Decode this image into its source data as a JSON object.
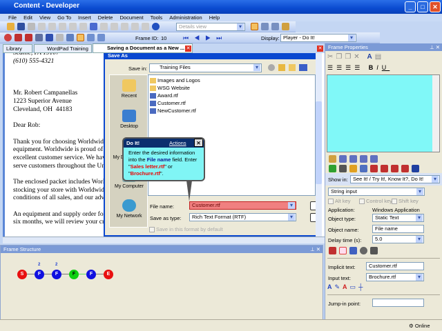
{
  "window": {
    "title": "Content - Developer"
  },
  "menu": [
    "File",
    "Edit",
    "View",
    "Go To",
    "Insert",
    "Delete",
    "Document",
    "Tools",
    "Administration",
    "Help"
  ],
  "toolbar": {
    "view_select": "Details view",
    "frame_id_label": "Frame ID:",
    "frame_id": "10",
    "display_label": "Display:",
    "display_value": "Player - Do It!"
  },
  "tabs": [
    {
      "label": "Library"
    },
    {
      "label": "WordPad Training"
    },
    {
      "label": "Saving a Document as a New ..."
    }
  ],
  "document": {
    "lines": [
      "Seattle, PA 19107",
      "(610) 555-4321",
      "",
      "",
      "",
      "Mr. Robert Campanellas",
      "1223 Superior Avenue",
      "Cleveland, OH  44183",
      "",
      "Dear Rob:",
      "",
      "Thank you for choosing Worldwide",
      "equipment. Worldwide is proud of",
      "excellent customer service. We hav",
      "serve customers throughout the Uni",
      "",
      "The enclosed packet includes Worl",
      "stocking your store with Worldwide",
      "conditions of all sales, and our adve",
      "",
      "An equipment and supply order for",
      "six months, we will review your credit"
    ]
  },
  "dialog": {
    "title": "Save As",
    "save_in_label": "Save in:",
    "save_in": "Training Files",
    "places": [
      "Recent",
      "Desktop",
      "My Documents",
      "My Computer",
      "My Network"
    ],
    "files": [
      "Images and Logos",
      "WSG Website",
      "Award.rtf",
      "Customer.rtf",
      "NewCustomer.rtf"
    ],
    "file_name_label": "File name:",
    "file_name": "Customer.rtf",
    "save_type_label": "Save as type:",
    "save_type": "Rich Text Format (RTF)",
    "default_checkbox": "Save in this format by default"
  },
  "callout": {
    "title": "Do It!",
    "actions": "Actions",
    "t1": "Enter the desired information into the ",
    "t2": "File name",
    "t3": " field. Enter \"",
    "t4": "Sales letter.rtf",
    "t5": "\" or \"",
    "t6": "Brochure.rtf",
    "t7": "\"."
  },
  "frame_structure": {
    "title": "Frame Structure",
    "nodes": [
      {
        "label": "S",
        "color": "#e81010"
      },
      {
        "label": "F",
        "color": "#1010e0",
        "badge": "2"
      },
      {
        "label": "F",
        "color": "#1010e0",
        "badge": "2"
      },
      {
        "label": "F",
        "color": "#10d010"
      },
      {
        "label": "F",
        "color": "#1010e0"
      },
      {
        "label": "E",
        "color": "#e81010"
      }
    ]
  },
  "frame_properties": {
    "title": "Frame Properties",
    "editor_color": "#80f8f8",
    "show_in_label": "Show in:",
    "show_in": "See It! / Try It!, Know It?, Do It!",
    "action": "String input",
    "alt_key": "Alt key",
    "control_key": "Control key",
    "shift_key": "Shift key",
    "application_label": "Application:",
    "application": "Windows Application",
    "object_type_label": "Object type:",
    "object_type": "Static Text",
    "object_name_label": "Object name:",
    "object_name": "File name",
    "delay_label": "Delay time (s):",
    "delay": "5.0",
    "implicit_label": "Implicit text:",
    "implicit": "Customer.rtf",
    "input_label": "Input text:",
    "input": "Brochure.rtf",
    "jump_label": "Jump-in point:",
    "jump": ""
  },
  "status": {
    "online": "Online"
  }
}
